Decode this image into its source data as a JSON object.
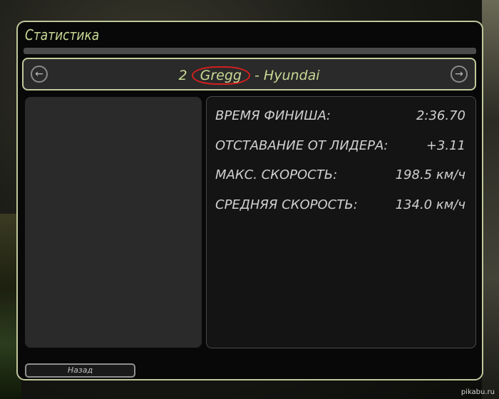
{
  "window": {
    "title": "Статистика"
  },
  "selector": {
    "position": "2",
    "driver": "Gregg",
    "separator": "-",
    "car": "Hyundai",
    "prev_icon": "arrow-left-circle-icon",
    "next_icon": "arrow-right-circle-icon"
  },
  "stats": [
    {
      "label": "ВРЕМЯ ФИНИША:",
      "value": "2:36.70"
    },
    {
      "label": "ОТСТАВАНИЕ ОТ ЛИДЕРА:",
      "value": "+3.11"
    },
    {
      "label": "МАКС. СКОРОСТЬ:",
      "value": "198.5 км/ч"
    },
    {
      "label": "СРЕДНЯЯ СКОРОСТЬ:",
      "value": "134.0 км/ч"
    }
  ],
  "footer": {
    "back_label": "Назад"
  },
  "watermark": "pikabu.ru",
  "colors": {
    "accent_text": "#c8d996",
    "panel_border": "#bfc79a",
    "highlight_circle": "#d41f1f"
  }
}
